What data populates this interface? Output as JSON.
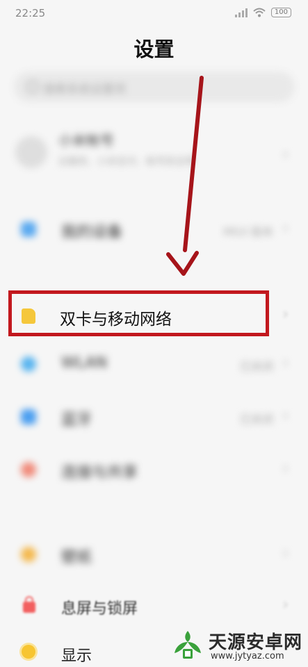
{
  "status_bar": {
    "time": "22:25",
    "battery": "100"
  },
  "header": {
    "title": "设置"
  },
  "search": {
    "placeholder": "搜索系统设置项"
  },
  "account": {
    "name": "小米帐号",
    "subtitle": "云服务、小米支付、帐号安全等"
  },
  "rows": {
    "my_device": {
      "label": "我的设备",
      "value": "MIUI 版本"
    },
    "sim": {
      "label": "双卡与移动网络"
    },
    "wlan": {
      "label": "WLAN",
      "value": "已关闭"
    },
    "bluetooth": {
      "label": "蓝牙",
      "value": "已关闭"
    },
    "hotspot": {
      "label": "连接与共享"
    },
    "wallpaper": {
      "label": "壁纸"
    },
    "lockscreen": {
      "label": "息屏与锁屏"
    },
    "display": {
      "label": "显示"
    }
  },
  "watermark": {
    "title": "天源安卓网",
    "url": "www.jytyaz.com"
  },
  "colors": {
    "highlight": "#c2181e",
    "arrow": "#a6141a",
    "sim_icon": "#f5c73b",
    "lock_icon": "#f26060",
    "display_icon": "#f7c531",
    "watermark_green": "#3aa13b"
  }
}
